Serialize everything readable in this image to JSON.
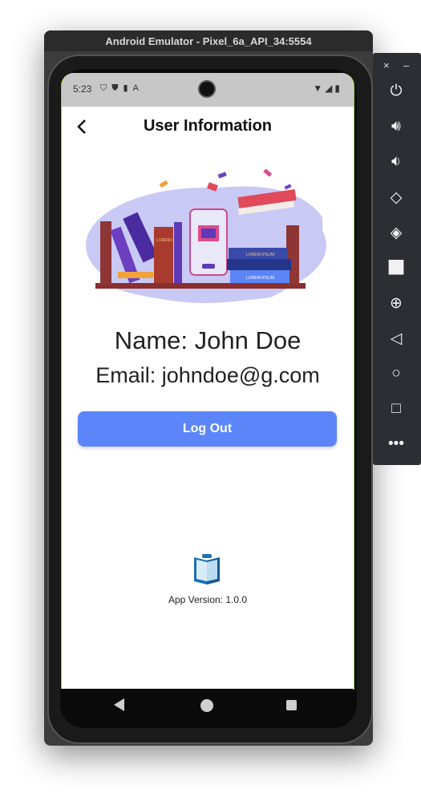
{
  "window": {
    "title": "Android Emulator - Pixel_6a_API_34:5554"
  },
  "status_bar": {
    "time": "5:23",
    "left_icons": [
      "shield-icon",
      "shield-icon",
      "sim-icon",
      "a-icon"
    ],
    "right_icons": [
      "wifi-icon",
      "signal-icon",
      "battery-icon"
    ]
  },
  "app_bar": {
    "title": "User Information"
  },
  "profile": {
    "name": "Name: John Doe",
    "email": "Email: johndoe@g.com"
  },
  "actions": {
    "logout_label": "Log Out"
  },
  "footer": {
    "version": "App Version: 1.0.0"
  },
  "illustration": {
    "book_title_1": "LOREM IPSUM",
    "book_title_2": "LOREM IPSUM",
    "book_title_3": "LOREM IPSUM"
  },
  "toolbar": {
    "close": "×",
    "minimize": "–",
    "buttons": [
      "power-icon",
      "volume-up-icon",
      "volume-down-icon",
      "rotate-left-icon",
      "rotate-right-icon",
      "camera-icon",
      "zoom-icon",
      "back-icon",
      "home-icon",
      "overview-icon",
      "more-icon"
    ]
  },
  "colors": {
    "accent": "#5b85f9",
    "status_bar": "#c7c7c7",
    "blob": "#c9c9f5"
  }
}
